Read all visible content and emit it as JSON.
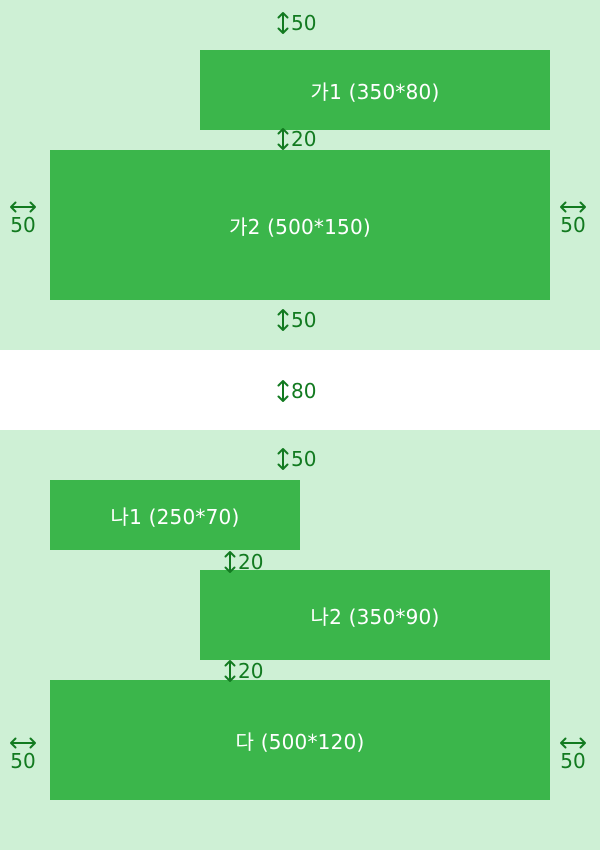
{
  "colors": {
    "panel_bg": "#cef0d5",
    "box_fill": "#3bb64b",
    "box_text": "#ffffff",
    "measure": "#127a20"
  },
  "top": {
    "margin_top": "50",
    "box_ga1": "가1 (350*80)",
    "gap_ga": "20",
    "box_ga2": "가2 (500*150)",
    "side_left": "50",
    "side_right": "50",
    "margin_bottom": "50"
  },
  "separator": "80",
  "bottom": {
    "margin_top": "50",
    "box_na1": "나1 (250*70)",
    "gap_na1": "20",
    "box_na2": "나2 (350*90)",
    "gap_na2": "20",
    "box_da": "다 (500*120)",
    "side_left": "50",
    "side_right": "50"
  }
}
